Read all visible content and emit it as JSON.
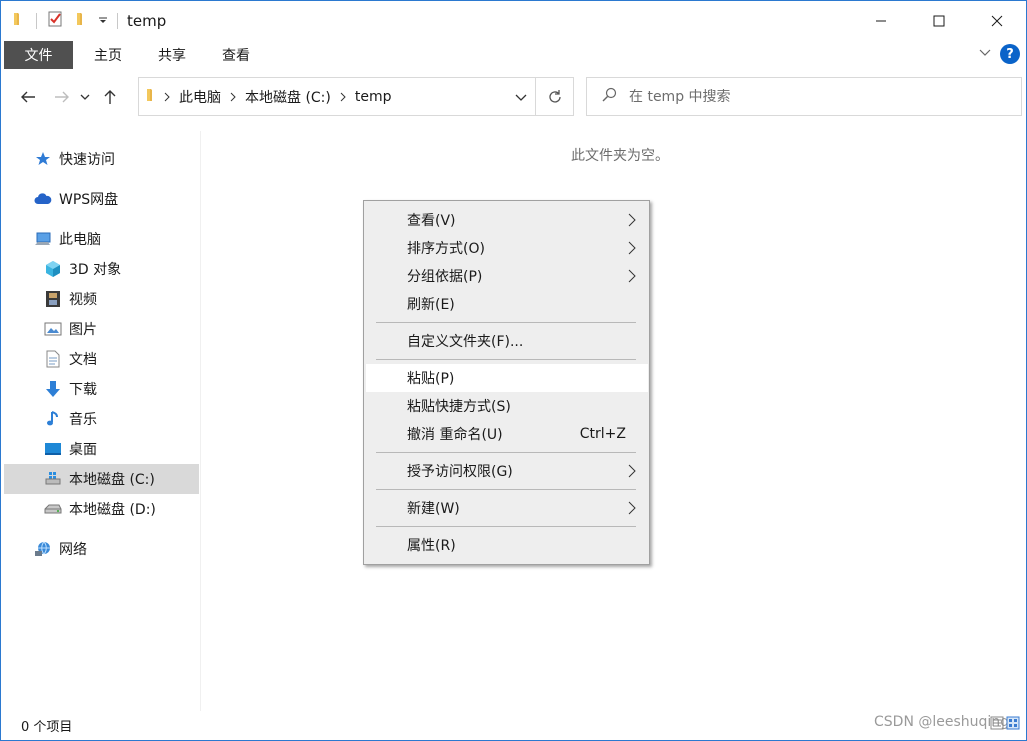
{
  "window": {
    "title": "temp"
  },
  "ribbon": {
    "tabs": [
      {
        "label": "文件"
      },
      {
        "label": "主页"
      },
      {
        "label": "共享"
      },
      {
        "label": "查看"
      }
    ],
    "help": "?"
  },
  "address": {
    "crumbs": [
      "此电脑",
      "本地磁盘 (C:)",
      "temp"
    ]
  },
  "search": {
    "placeholder": "在 temp 中搜索"
  },
  "sidebar": {
    "items": [
      {
        "label": "快速访问",
        "icon": "star-icon"
      },
      {
        "label": "WPS网盘",
        "icon": "cloud-icon"
      },
      {
        "label": "此电脑",
        "icon": "computer-icon"
      },
      {
        "label": "3D 对象",
        "icon": "cube-icon"
      },
      {
        "label": "视频",
        "icon": "film-icon"
      },
      {
        "label": "图片",
        "icon": "picture-icon"
      },
      {
        "label": "文档",
        "icon": "document-icon"
      },
      {
        "label": "下载",
        "icon": "download-arrow-icon"
      },
      {
        "label": "音乐",
        "icon": "music-note-icon"
      },
      {
        "label": "桌面",
        "icon": "desktop-icon"
      },
      {
        "label": "本地磁盘 (C:)",
        "icon": "windows-drive-icon"
      },
      {
        "label": "本地磁盘 (D:)",
        "icon": "drive-icon"
      },
      {
        "label": "网络",
        "icon": "network-icon"
      }
    ]
  },
  "content": {
    "empty_message": "此文件夹为空。"
  },
  "context_menu": {
    "items": [
      {
        "label": "查看(V)"
      },
      {
        "label": "排序方式(O)"
      },
      {
        "label": "分组依据(P)"
      },
      {
        "label": "刷新(E)"
      },
      {
        "label": "自定义文件夹(F)..."
      },
      {
        "label": "粘贴(P)"
      },
      {
        "label": "粘贴快捷方式(S)"
      },
      {
        "label": "撤消 重命名(U)",
        "shortcut": "Ctrl+Z"
      },
      {
        "label": "授予访问权限(G)"
      },
      {
        "label": "新建(W)"
      },
      {
        "label": "属性(R)"
      }
    ]
  },
  "status": {
    "item_count": "0 个项目"
  },
  "watermark": "CSDN @leeshuqing"
}
